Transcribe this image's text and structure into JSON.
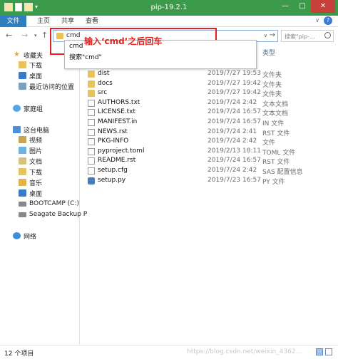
{
  "window": {
    "title": "pip-19.2.1"
  },
  "ribbon": {
    "tabs": [
      "文件",
      "主页",
      "共享",
      "查看"
    ]
  },
  "address": {
    "value": "cmd",
    "search_placeholder": "搜索\"pip-..."
  },
  "annotation": {
    "text": "输入‘cmd’之后回车",
    "color": "#e4201f"
  },
  "autocomplete": {
    "items": [
      "cmd",
      "搜索\"cmd\""
    ]
  },
  "sidebar": {
    "favorites": {
      "label": "收藏夹",
      "items": [
        "下载",
        "桌面",
        "最近访问的位置"
      ]
    },
    "homegroup": "家庭组",
    "thispc": {
      "label": "这台电脑",
      "items": [
        "视频",
        "图片",
        "文档",
        "下载",
        "音乐",
        "桌面",
        "BOOTCAMP (C:)",
        "Seagate Backup P"
      ]
    },
    "network": "网络"
  },
  "columns": {
    "type": "类型"
  },
  "files": [
    {
      "name": "dist",
      "date": "2019/7/27 19:53",
      "type": "文件夹",
      "kind": "folder"
    },
    {
      "name": "docs",
      "date": "2019/7/27 19:42",
      "type": "文件夹",
      "kind": "folder"
    },
    {
      "name": "src",
      "date": "2019/7/27 19:42",
      "type": "文件夹",
      "kind": "folder"
    },
    {
      "name": "AUTHORS.txt",
      "date": "2019/7/24 2:42",
      "type": "文本文档",
      "kind": "file"
    },
    {
      "name": "LICENSE.txt",
      "date": "2019/7/24 16:57",
      "type": "文本文档",
      "kind": "file"
    },
    {
      "name": "MANIFEST.in",
      "date": "2019/7/24 16:57",
      "type": "IN 文件",
      "kind": "file"
    },
    {
      "name": "NEWS.rst",
      "date": "2019/7/24 2:41",
      "type": "RST 文件",
      "kind": "file"
    },
    {
      "name": "PKG-INFO",
      "date": "2019/7/24 2:42",
      "type": "文件",
      "kind": "file"
    },
    {
      "name": "pyproject.toml",
      "date": "2019/2/13 18:11",
      "type": "TOML 文件",
      "kind": "file"
    },
    {
      "name": "README.rst",
      "date": "2019/7/24 16:57",
      "type": "RST 文件",
      "kind": "file"
    },
    {
      "name": "setup.cfg",
      "date": "2019/7/24 2:42",
      "type": "SAS 配置信息",
      "kind": "file"
    },
    {
      "name": "setup.py",
      "date": "2019/7/23 16:57",
      "type": "PY 文件",
      "kind": "py"
    }
  ],
  "status": {
    "count": "12 个项目",
    "watermark": "https://blog.csdn.net/weixin_4362..."
  }
}
